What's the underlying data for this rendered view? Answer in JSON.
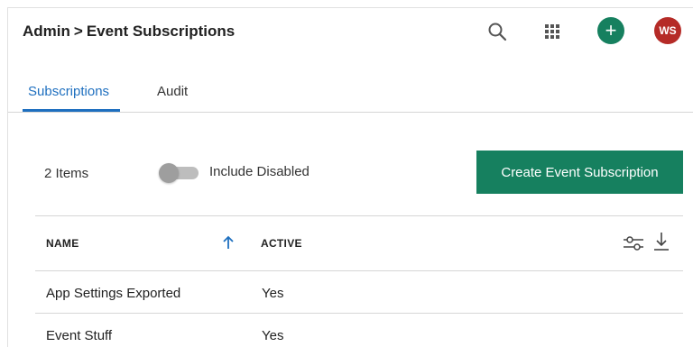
{
  "header": {
    "breadcrumb_root": "Admin",
    "breadcrumb_separator": ">",
    "breadcrumb_current": "Event Subscriptions",
    "add_symbol": "+",
    "avatar_initials": "WS",
    "accent_color": "#16805f",
    "avatar_color": "#b52b27"
  },
  "tabs": [
    {
      "label": "Subscriptions",
      "active": true
    },
    {
      "label": "Audit",
      "active": false
    }
  ],
  "toolbar": {
    "item_count": "2 Items",
    "include_disabled_label": "Include Disabled",
    "include_disabled_on": false,
    "create_button_label": "Create Event Subscription"
  },
  "table": {
    "columns": [
      "NAME",
      "ACTIVE"
    ],
    "sort_column": "NAME",
    "sort_direction": "ascending",
    "rows": [
      {
        "name": "App Settings Exported",
        "active": "Yes"
      },
      {
        "name": "Event Stuff",
        "active": "Yes"
      }
    ]
  },
  "icons": [
    "search-icon",
    "apps-grid-icon",
    "add-icon",
    "sort-ascending-icon",
    "column-settings-icon",
    "download-icon"
  ],
  "link_color": "#1e6fbf"
}
